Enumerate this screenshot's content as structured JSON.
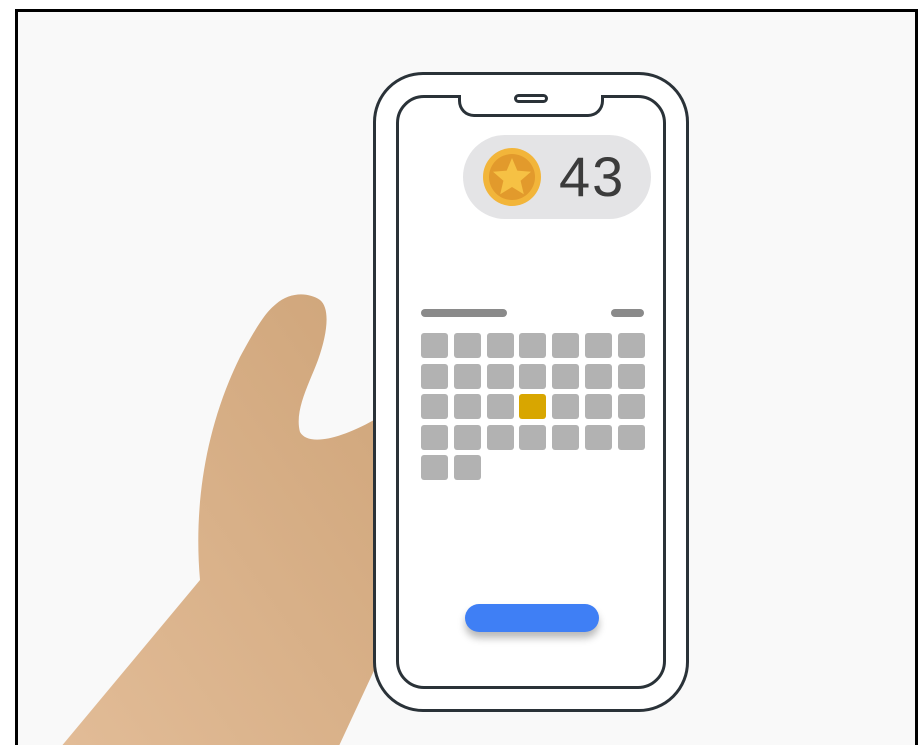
{
  "wallet": {
    "coin_count": "43",
    "coin_icon": "star-coin-icon"
  },
  "calendar": {
    "days_total": 30,
    "selected_day": 18,
    "day_color": "#b2b2b2",
    "selected_color": "#d8a600"
  },
  "action_button": {
    "label": "",
    "color": "#3f7ff5"
  },
  "colors": {
    "background": "#f9f9f9",
    "phone_outline": "#2a3238",
    "pill": "#e4e4e6",
    "skin": "#d9b08a"
  }
}
